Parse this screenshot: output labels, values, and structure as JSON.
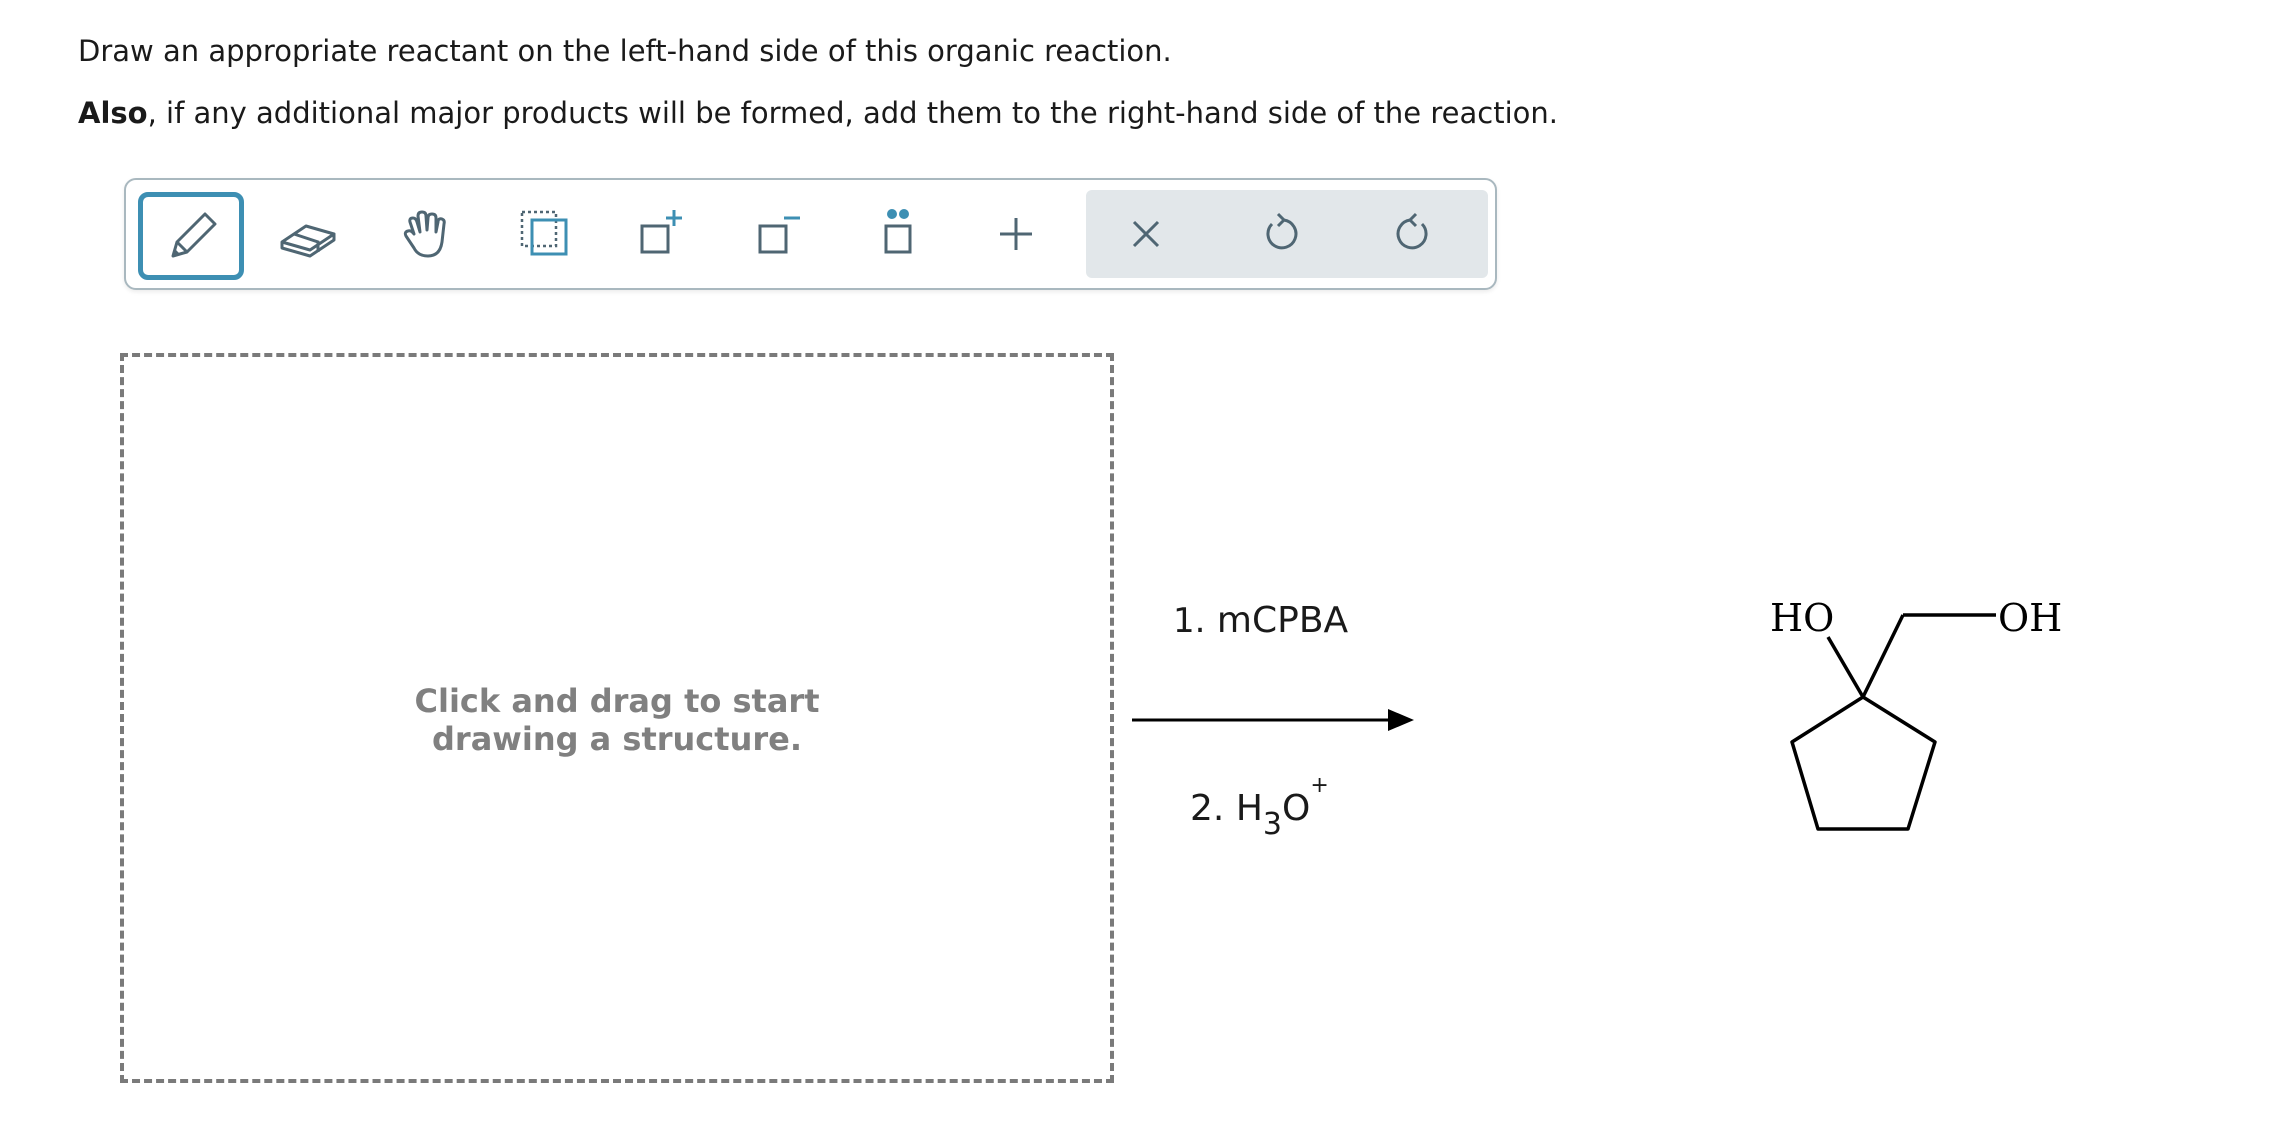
{
  "question": {
    "line1": "Draw an appropriate reactant on the left-hand side of this organic reaction.",
    "line2_bold": "Also",
    "line2_rest": ", if any additional major products will be formed, add them to the right-hand side of the reaction."
  },
  "toolbar": {
    "tools": [
      "pencil-tool",
      "eraser-tool",
      "hand-tool",
      "select-tool",
      "add-charge-positive-tool",
      "add-charge-negative-tool",
      "lone-pair-tool",
      "plus-tool",
      "clear-tool",
      "undo-tool",
      "redo-tool"
    ],
    "active_tool": "pencil-tool",
    "accent_color": "#3d8fb3",
    "icon_color": "#4f6673"
  },
  "canvas": {
    "hint_line1": "Click and drag to start",
    "hint_line2": "drawing a structure."
  },
  "reaction": {
    "step1_num": "1.",
    "step1_reagent": "mCPBA",
    "step2_num": "2.",
    "step2_H": "H",
    "step2_sub": "3",
    "step2_O": "O",
    "step2_charge": "+"
  },
  "product": {
    "label_left": "HO",
    "label_right": "OH"
  }
}
